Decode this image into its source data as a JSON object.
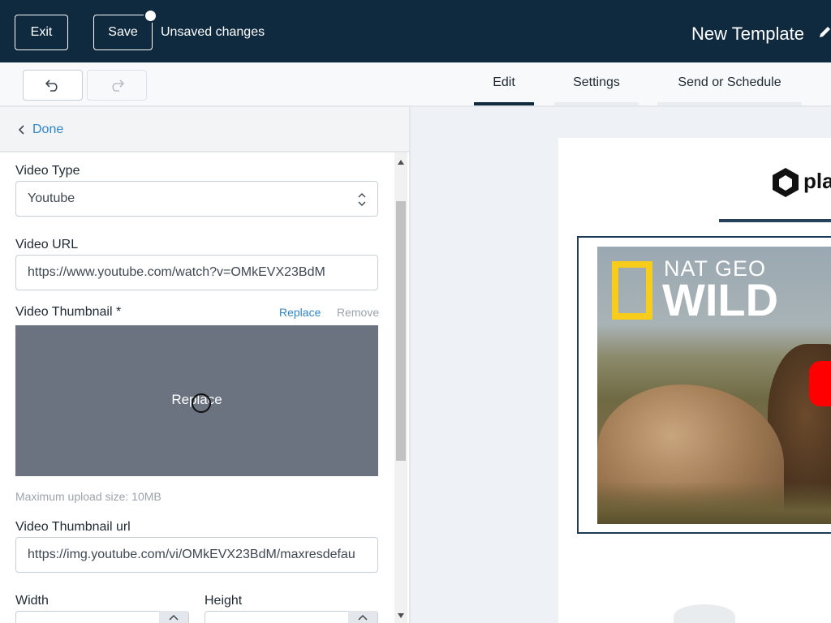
{
  "header": {
    "exit_label": "Exit",
    "save_label": "Save",
    "status_text": "Unsaved changes",
    "template_title": "New Template"
  },
  "toolbar": {
    "tabs": [
      {
        "label": "Edit",
        "active": true
      },
      {
        "label": "Settings",
        "active": false
      },
      {
        "label": "Send or Schedule",
        "active": false
      }
    ]
  },
  "panel": {
    "done_label": "Done",
    "video_type": {
      "label": "Video Type",
      "value": "Youtube"
    },
    "video_url": {
      "label": "Video URL",
      "value": "https://www.youtube.com/watch?v=OMkEVX23BdM"
    },
    "thumbnail": {
      "label": "Video Thumbnail *",
      "replace_link": "Replace",
      "remove_link": "Remove",
      "overlay_text": "Replace",
      "hint": "Maximum upload size: 10MB"
    },
    "thumbnail_url": {
      "label": "Video Thumbnail url",
      "value": "https://img.youtube.com/vi/OMkEVX23BdM/maxresdefau"
    },
    "width_label": "Width",
    "height_label": "Height"
  },
  "preview": {
    "logo_text": "pla",
    "video_brand_top": "NAT GEO",
    "video_brand_bottom": "WILD"
  },
  "colors": {
    "header_bg": "#0f2a3f",
    "link": "#2f86c8",
    "brand_yellow": "#f7cc1a",
    "play_red": "#ff0000"
  },
  "icons": [
    "pencil-icon",
    "undo-icon",
    "redo-icon",
    "chevron-left-icon",
    "select-arrows-icon",
    "cursor-icon",
    "logo-icon",
    "play-icon"
  ]
}
